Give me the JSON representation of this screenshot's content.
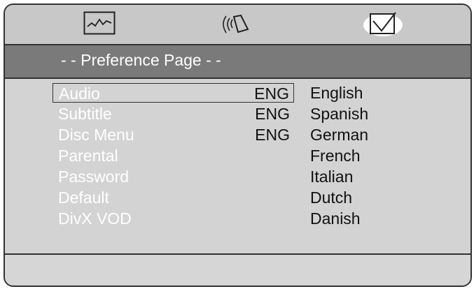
{
  "tabs": [
    {
      "icon": "waveform-icon"
    },
    {
      "icon": "speaker-icon"
    },
    {
      "icon": "checkbox-icon"
    }
  ],
  "header": {
    "title": "- - Preference Page - -"
  },
  "menu": [
    {
      "label": "Audio",
      "value": "ENG",
      "selected": true
    },
    {
      "label": "Subtitle",
      "value": "ENG"
    },
    {
      "label": "Disc Menu",
      "value": "ENG"
    },
    {
      "label": "Parental",
      "value": ""
    },
    {
      "label": "Password",
      "value": ""
    },
    {
      "label": "Default",
      "value": ""
    },
    {
      "label": "DivX VOD",
      "value": ""
    }
  ],
  "options": [
    "English",
    "Spanish",
    "German",
    "French",
    "Italian",
    "Dutch",
    "Danish"
  ]
}
